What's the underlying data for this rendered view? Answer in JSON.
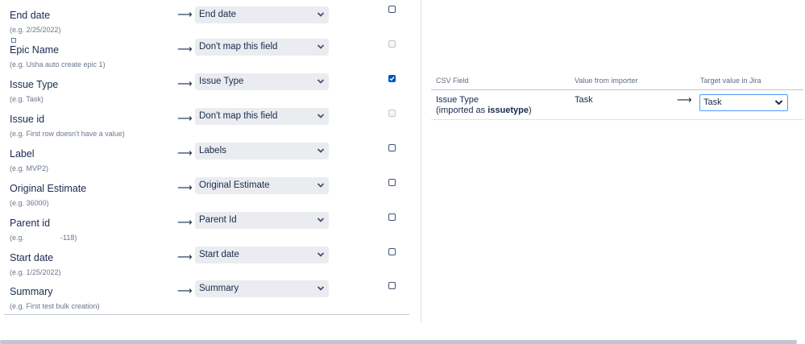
{
  "fields": [
    {
      "name": "End date",
      "example": "(e.g. 2/25/2022)",
      "target": "End date",
      "checkbox": "unchecked"
    },
    {
      "name": "Epic Name",
      "example": "(e.g. Usha auto create epic 1)",
      "target": "Don't map this field",
      "checkbox": "disabled"
    },
    {
      "name": "Issue Type",
      "example": "(e.g. Task)",
      "target": "Issue Type",
      "checkbox": "checked"
    },
    {
      "name": "Issue id",
      "example": "(e.g. First row doesn't have a value)",
      "target": "Don't map this field",
      "checkbox": "disabled"
    },
    {
      "name": "Label",
      "example": "(e.g. MVP2)",
      "target": "Labels",
      "checkbox": "unchecked"
    },
    {
      "name": "Original Estimate",
      "example": "(e.g. 36000)",
      "target": "Original Estimate",
      "checkbox": "unchecked"
    },
    {
      "name": "Parent id",
      "example": "(e.g.                  -118)",
      "target": "Parent Id",
      "checkbox": "unchecked"
    },
    {
      "name": "Start date",
      "example": "(e.g. 1/25/2022)",
      "target": "Start date",
      "checkbox": "unchecked"
    },
    {
      "name": "Summary",
      "example": "(e.g. First test bulk creation)",
      "target": "Summary",
      "checkbox": "unchecked"
    }
  ],
  "arrow_glyph": "⟶",
  "value_mapping": {
    "headers": {
      "csv_field": "CSV Field",
      "value_from_importer": "Value from importer",
      "target_value": "Target value in Jira"
    },
    "rows": [
      {
        "csv_field": "Issue Type",
        "imported_as_prefix": "(imported as ",
        "imported_as_name": "issuetype",
        "imported_as_suffix": ")",
        "value": "Task",
        "target": "Task"
      }
    ]
  },
  "colors": {
    "accent": "#0052cc",
    "focus_border": "#4c9aff",
    "select_bg": "#ebecf0",
    "text": "#172b4d",
    "muted": "#6b778c"
  }
}
